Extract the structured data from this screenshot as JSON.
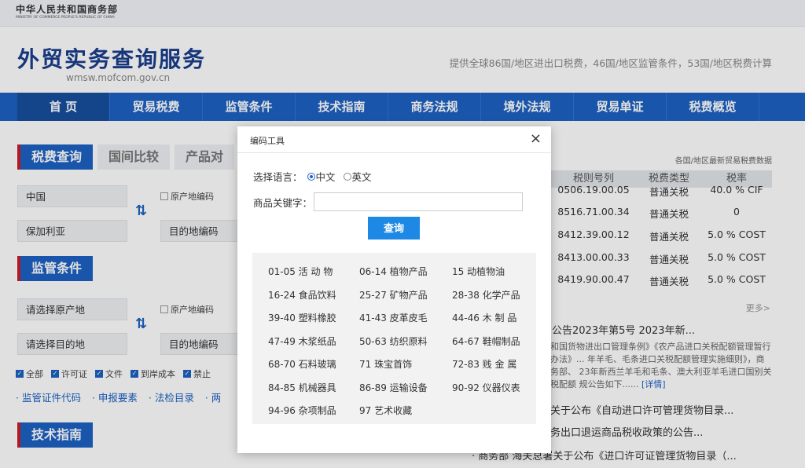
{
  "ministry": {
    "cn": "中华人民共和国商务部",
    "en": "MINISTRY OF COMMERCE PEOPLE'S REPUBLIC OF CHINA"
  },
  "site": {
    "title": "外贸实务查询服务",
    "url": "wmsw.mofcom.gov.cn",
    "tagline": "提供全球86国/地区进出口税费，46国/地区监管条件，53国/地区税费计算"
  },
  "nav": [
    "首 页",
    "贸易税费",
    "监管条件",
    "技术指南",
    "商务法规",
    "境外法规",
    "贸易单证",
    "税费概览"
  ],
  "tabs": [
    "税费查询",
    "国间比较",
    "产品对"
  ],
  "fields": {
    "origin_country": "中国",
    "dest_country": "保加利亚",
    "origin_code_check": "原产地编码",
    "dest_code": "目的地编码",
    "select_origin": "请选择原产地",
    "select_dest": "请选择目的地"
  },
  "sections": {
    "regulation": "监管条件",
    "tech": "技术指南"
  },
  "checks": [
    "全部",
    "许可证",
    "文件",
    "到岸成本",
    "禁止"
  ],
  "links": [
    "· 监管证件代码",
    "· 申报要素",
    "· 法检目录",
    "· 两"
  ],
  "right": {
    "note": "各国/地区最新贸易税费数据",
    "headers": [
      "税则号列",
      "税费类型",
      "税率"
    ],
    "rows": [
      [
        "0506.19.00.05",
        "普通关税",
        "40.0 % CIF"
      ],
      [
        "8516.71.00.34",
        "普通关税",
        "0"
      ],
      [
        "8412.39.00.12",
        "普通关税",
        "5.0 % COST"
      ],
      [
        "8413.00.00.33",
        "普通关税",
        "5.0 % COST"
      ],
      [
        "8419.90.00.47",
        "普通关税",
        "5.0 % COST"
      ]
    ],
    "more": "更多>",
    "news1": "公告2023年第5号 2023年新...",
    "news_body": "和国货物进出口管理条例》《农产品进口关税配额管理暂行办法》... 年羊毛、毛条进口关税配额管理实施细则》，商务部、 23年新西兰羊毛和毛条、澳大利亚羊毛进口国别关税配额 规公告如下......",
    "detail": "[详情]",
    "news2": "关于公布《自动进口许可管理货物目录...",
    "news3": "务出口退运商品税收政策的公告...",
    "news4": "· 商务部 海关总署关于公布《进口许可证管理货物目录（..."
  },
  "modal": {
    "title": "编码工具",
    "close": "×",
    "lang_label": "选择语言：",
    "lang_cn": "中文",
    "lang_en": "英文",
    "kw_label": "商品关键字：",
    "kw_value": "",
    "kw_placeholder": "",
    "query": "查询",
    "categories": [
      [
        "01-05 活  动  物",
        "06-14 植物产品",
        "15      动植物油"
      ],
      [
        "16-24 食品饮料",
        "25-27 矿物产品",
        "28-38 化学产品"
      ],
      [
        "39-40 塑料橡胶",
        "41-43 皮革皮毛",
        "44-46 木  制  品"
      ],
      [
        "47-49 木浆纸品",
        "50-63 纺织原料",
        "64-67 鞋帽制品"
      ],
      [
        "68-70 石料玻璃",
        "71      珠宝首饰",
        "72-83 贱  金  属"
      ],
      [
        "84-85 机械器具",
        "86-89 运输设备",
        "90-92 仪器仪表"
      ],
      [
        "94-96 杂项制品",
        "97      艺术收藏",
        ""
      ]
    ]
  },
  "colors": {
    "primary": "#1d62c3",
    "accent_red": "#c91f28",
    "button": "#1e88e5"
  }
}
